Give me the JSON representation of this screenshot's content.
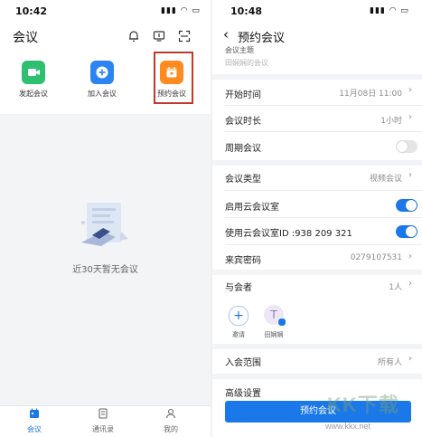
{
  "left": {
    "status_time": "10:42",
    "title": "会议",
    "actions": [
      {
        "label": "发起会议",
        "color": "#2fbf71",
        "icon": "video-icon"
      },
      {
        "label": "加入会议",
        "color": "#2b84f0",
        "icon": "plus-icon"
      },
      {
        "label": "预约会议",
        "color": "#ff8a1f",
        "icon": "calendar-icon"
      }
    ],
    "empty_text": "近30天暂无会议",
    "tabs": [
      {
        "label": "会议",
        "icon": "calendar-icon",
        "active": true
      },
      {
        "label": "通讯录",
        "icon": "contacts-icon",
        "active": false
      },
      {
        "label": "我的",
        "icon": "person-icon",
        "active": false
      }
    ]
  },
  "right": {
    "status_time": "10:48",
    "title": "预约会议",
    "subject_label": "会议主题",
    "subject_placeholder": "田娴娴的会议",
    "start_time_label": "开始时间",
    "start_time_value": "11月08日 11:00",
    "duration_label": "会议时长",
    "duration_value": "1小时",
    "recurring_label": "周期会议",
    "recurring_on": false,
    "type_label": "会议类型",
    "type_value": "视频会议",
    "cloud_room_label": "启用云会议室",
    "cloud_room_on": true,
    "cloud_id_label": "使用云会议室ID :938 209 321",
    "cloud_id_on": true,
    "password_label": "来宾密码",
    "password_value": "0279107531",
    "participants_label": "与会者",
    "participants_value": "1人",
    "invite_label": "邀请",
    "participant_initial": "T",
    "participant_name": "田娴娴",
    "scope_label": "入会范围",
    "scope_value": "所有人",
    "advanced_label": "高级设置",
    "submit_label": "预约会议",
    "accent": "#1a78e8"
  },
  "watermark": {
    "brand": "KK下载",
    "url": "www.kkx.net"
  }
}
